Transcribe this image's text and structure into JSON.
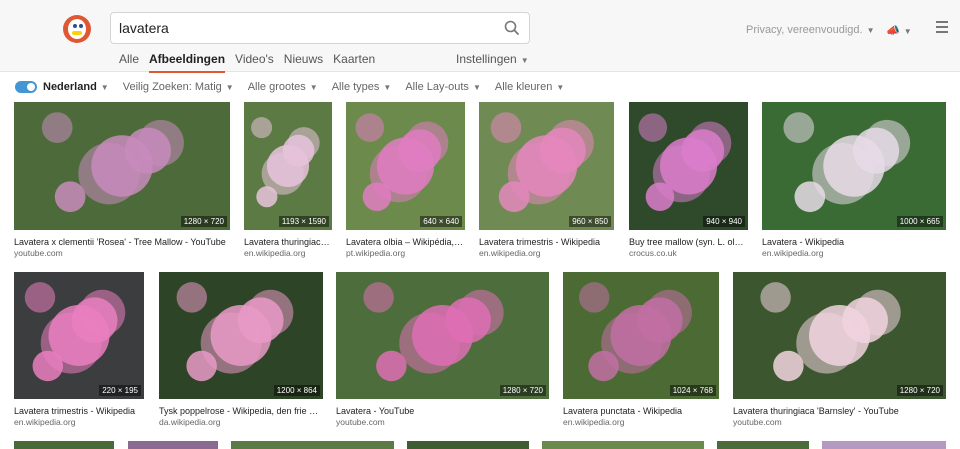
{
  "search": {
    "query": "lavatera"
  },
  "nav": [
    "Alle",
    "Afbeeldingen",
    "Video's",
    "Nieuws",
    "Kaarten"
  ],
  "settings": "Instellingen",
  "privacy": "Privacy, vereenvoudigd.",
  "filters": {
    "region": "Nederland",
    "safe": "Veilig Zoeken: Matig",
    "size": "Alle grootes",
    "type": "Alle types",
    "layout": "Alle Lay-outs",
    "color": "Alle kleuren"
  },
  "images": [
    {
      "title": "Lavatera x clementii 'Rosea' - Tree Mallow - YouTube",
      "source": "youtube.com",
      "dims": "1280 × 720",
      "bg": "#4d6b3a",
      "accent": "#c98bbd"
    },
    {
      "title": "Lavatera thuringiaca - Wikipedia",
      "source": "en.wikipedia.org",
      "dims": "1193 × 1590",
      "bg": "#5c7a43",
      "accent": "#e8c3dc"
    },
    {
      "title": "Lavatera olbia – Wikipédia, a enciclopédia livre",
      "source": "pt.wikipedia.org",
      "dims": "640 × 640",
      "bg": "#6d8a4d",
      "accent": "#e07cc2"
    },
    {
      "title": "Lavatera trimestris - Wikipedia",
      "source": "en.wikipedia.org",
      "dims": "960 × 850",
      "bg": "#6f8a53",
      "accent": "#e587bd"
    },
    {
      "title": "Buy tree mallow (syn. L. olbia)",
      "source": "crocus.co.uk",
      "dims": "940 × 940",
      "bg": "#2e4a2a",
      "accent": "#db7ccb"
    },
    {
      "title": "Lavatera - Wikipedia",
      "source": "en.wikipedia.org",
      "dims": "1000 × 665",
      "bg": "#3a6b34",
      "accent": "#e8dbe8"
    },
    {
      "title": "Lavatera trimestris - Wikipedia",
      "source": "en.wikipedia.org",
      "dims": "220 × 195",
      "bg": "#3b3d3e",
      "accent": "#ea7fc0"
    },
    {
      "title": "Tysk poppelrose - Wikipedia, den frie encyklopædi",
      "source": "da.wikipedia.org",
      "dims": "1200 × 864",
      "bg": "#2d4426",
      "accent": "#e99ac8"
    },
    {
      "title": "Lavatera - YouTube",
      "source": "youtube.com",
      "dims": "1280 × 720",
      "bg": "#4d6e3c",
      "accent": "#df6fb4"
    },
    {
      "title": "Lavatera punctata - Wikipedia",
      "source": "en.wikipedia.org",
      "dims": "1024 × 768",
      "bg": "#4c6a34",
      "accent": "#c26fa5"
    },
    {
      "title": "Lavatera thuringiaca 'Barnsley' - YouTube",
      "source": "youtube.com",
      "dims": "1280 × 720",
      "bg": "#3c5630",
      "accent": "#f1d4df"
    }
  ]
}
